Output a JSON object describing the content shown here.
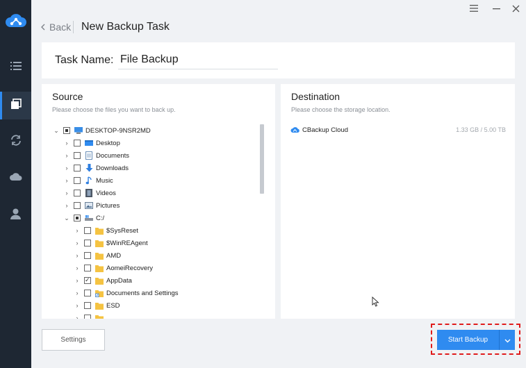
{
  "nav": {
    "items": [
      {
        "icon": "list-icon"
      },
      {
        "icon": "backup-copy-icon",
        "active": true
      },
      {
        "icon": "sync-icon"
      },
      {
        "icon": "cloud-icon"
      },
      {
        "icon": "user-icon"
      }
    ]
  },
  "window": {
    "menu_icon": "menu-icon",
    "close_icon": "close-icon"
  },
  "header": {
    "back_label": "Back",
    "title": "New Backup Task"
  },
  "task": {
    "label": "Task Name:",
    "value": "File Backup"
  },
  "source": {
    "title": "Source",
    "subtitle": "Please choose the files you want to back up.",
    "tree": [
      {
        "label": "DESKTOP-9NSR2MD",
        "level": 0,
        "expanded": true,
        "check": "partial",
        "icon": "computer-icon"
      },
      {
        "label": "Desktop",
        "level": 1,
        "expanded": false,
        "check": "none",
        "icon": "desktop-folder-icon"
      },
      {
        "label": "Documents",
        "level": 1,
        "expanded": false,
        "check": "none",
        "icon": "documents-icon"
      },
      {
        "label": "Downloads",
        "level": 1,
        "expanded": false,
        "check": "none",
        "icon": "download-icon"
      },
      {
        "label": "Music",
        "level": 1,
        "expanded": false,
        "check": "none",
        "icon": "music-icon"
      },
      {
        "label": "Videos",
        "level": 1,
        "expanded": false,
        "check": "none",
        "icon": "video-icon"
      },
      {
        "label": "Pictures",
        "level": 1,
        "expanded": false,
        "check": "none",
        "icon": "pictures-icon"
      },
      {
        "label": "C:/",
        "level": 1,
        "expanded": true,
        "check": "partial",
        "icon": "drive-icon"
      },
      {
        "label": "$SysReset",
        "level": 2,
        "expanded": false,
        "check": "none",
        "icon": "folder-icon"
      },
      {
        "label": "$WinREAgent",
        "level": 2,
        "expanded": false,
        "check": "none",
        "icon": "folder-icon"
      },
      {
        "label": "AMD",
        "level": 2,
        "expanded": false,
        "check": "none",
        "icon": "folder-icon"
      },
      {
        "label": "AomeiRecovery",
        "level": 2,
        "expanded": false,
        "check": "none",
        "icon": "folder-icon"
      },
      {
        "label": "AppData",
        "level": 2,
        "expanded": false,
        "check": "checked",
        "icon": "folder-icon"
      },
      {
        "label": "Documents and Settings",
        "level": 2,
        "expanded": false,
        "check": "none",
        "icon": "shortcut-folder-icon"
      },
      {
        "label": "ESD",
        "level": 2,
        "expanded": false,
        "check": "none",
        "icon": "folder-icon"
      }
    ]
  },
  "destination": {
    "title": "Destination",
    "subtitle": "Please choose the storage location.",
    "items": [
      {
        "label": "CBackup Cloud",
        "size": "1.33 GB / 5.00 TB",
        "icon": "cbackup-cloud-icon"
      }
    ]
  },
  "footer": {
    "settings_label": "Settings",
    "start_label": "Start Backup",
    "dropdown_icon": "chevron-down-icon"
  },
  "colors": {
    "nav_bg": "#1e2733",
    "accent": "#2f8bf0",
    "highlight": "#e01b1b",
    "bg": "#f0f2f5"
  }
}
